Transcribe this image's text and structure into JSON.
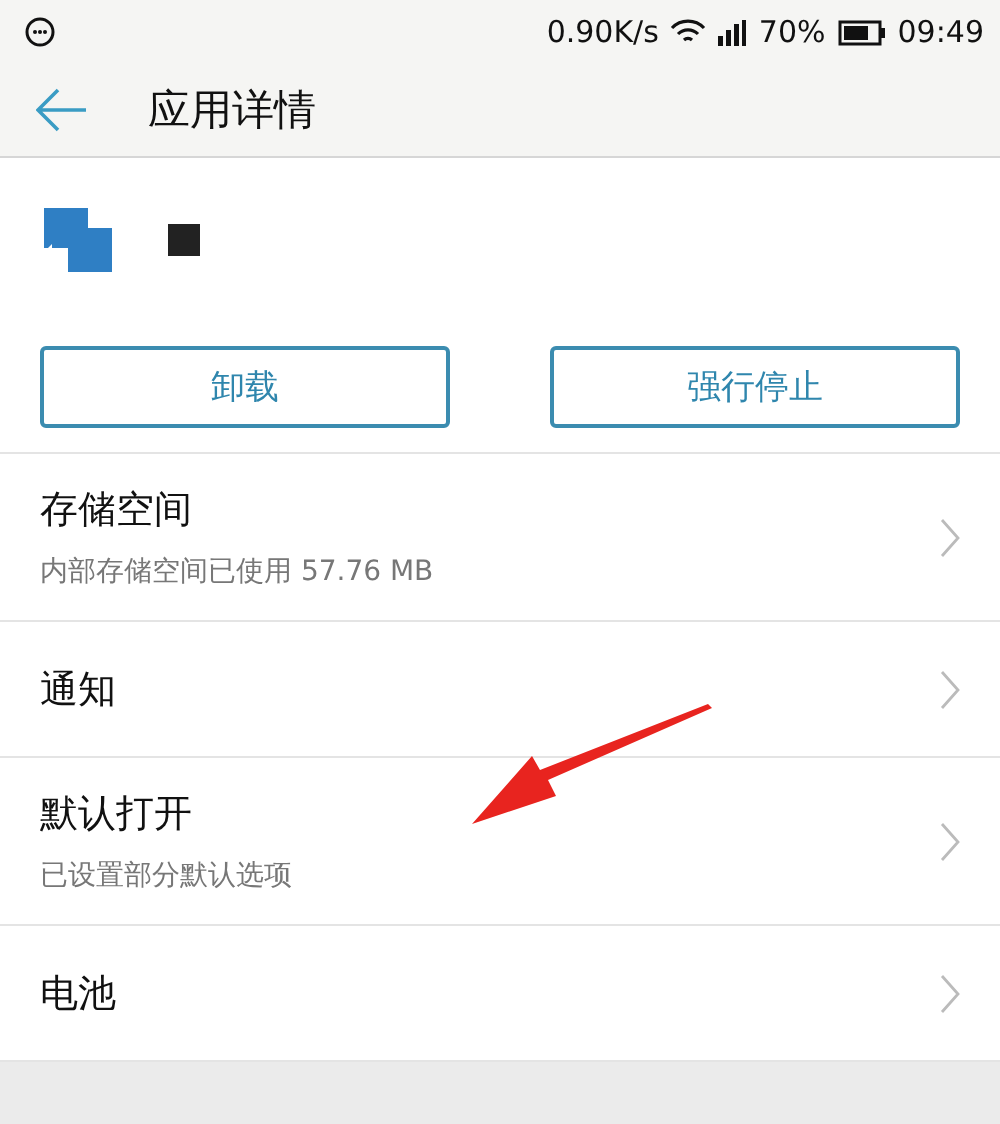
{
  "status_bar": {
    "speed": "0.90K/s",
    "battery": "70%",
    "time": "09:49"
  },
  "header": {
    "title": "应用详情"
  },
  "buttons": [
    {
      "label": "卸载"
    },
    {
      "label": "强行停止"
    }
  ],
  "rows": [
    {
      "title": "存储空间",
      "subtitle": "内部存储空间已使用 57.76 MB"
    },
    {
      "title": "通知"
    },
    {
      "title": "默认打开",
      "subtitle": "已设置部分默认选项"
    },
    {
      "title": "电池"
    }
  ]
}
